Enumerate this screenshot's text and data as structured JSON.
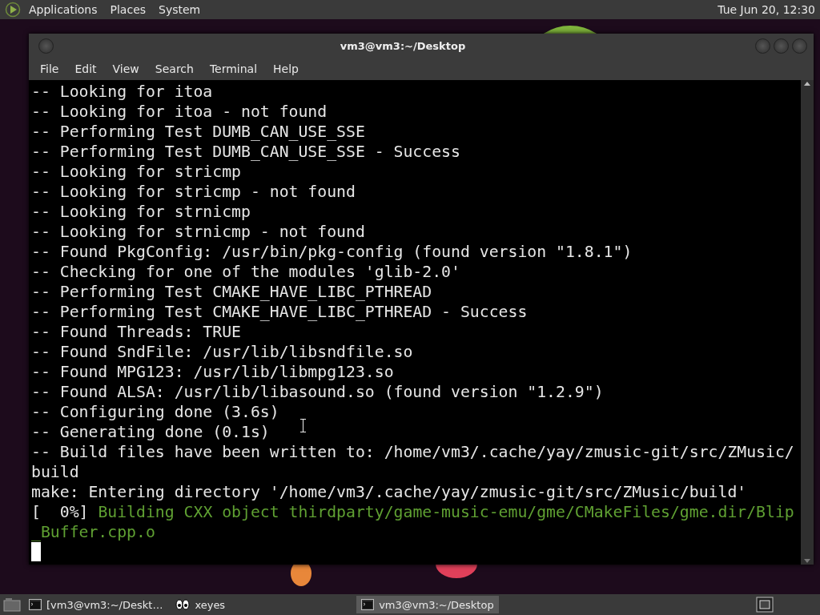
{
  "top_panel": {
    "menus": [
      "Applications",
      "Places",
      "System"
    ],
    "clock": "Tue Jun 20, 12:30"
  },
  "window": {
    "title": "vm3@vm3:~/Desktop",
    "menu": [
      "File",
      "Edit",
      "View",
      "Search",
      "Terminal",
      "Help"
    ],
    "terminal": {
      "cursor": true,
      "lines": [
        [
          {
            "text": "-- Looking for itoa",
            "kind": "plain"
          }
        ],
        [
          {
            "text": "-- Looking for itoa - not found",
            "kind": "plain"
          }
        ],
        [
          {
            "text": "-- Performing Test DUMB_CAN_USE_SSE",
            "kind": "plain"
          }
        ],
        [
          {
            "text": "-- Performing Test DUMB_CAN_USE_SSE - Success",
            "kind": "plain"
          }
        ],
        [
          {
            "text": "-- Looking for stricmp",
            "kind": "plain"
          }
        ],
        [
          {
            "text": "-- Looking for stricmp - not found",
            "kind": "plain"
          }
        ],
        [
          {
            "text": "-- Looking for strnicmp",
            "kind": "plain"
          }
        ],
        [
          {
            "text": "-- Looking for strnicmp - not found",
            "kind": "plain"
          }
        ],
        [
          {
            "text": "-- Found PkgConfig: /usr/bin/pkg-config (found version \"1.8.1\")",
            "kind": "plain"
          }
        ],
        [
          {
            "text": "-- Checking for one of the modules 'glib-2.0'",
            "kind": "plain"
          }
        ],
        [
          {
            "text": "-- Performing Test CMAKE_HAVE_LIBC_PTHREAD",
            "kind": "plain"
          }
        ],
        [
          {
            "text": "-- Performing Test CMAKE_HAVE_LIBC_PTHREAD - Success",
            "kind": "plain"
          }
        ],
        [
          {
            "text": "-- Found Threads: TRUE",
            "kind": "plain"
          }
        ],
        [
          {
            "text": "-- Found SndFile: /usr/lib/libsndfile.so",
            "kind": "plain"
          }
        ],
        [
          {
            "text": "-- Found MPG123: /usr/lib/libmpg123.so",
            "kind": "plain"
          }
        ],
        [
          {
            "text": "-- Found ALSA: /usr/lib/libasound.so (found version \"1.2.9\")",
            "kind": "plain"
          }
        ],
        [
          {
            "text": "-- Configuring done (3.6s)",
            "kind": "plain"
          }
        ],
        [
          {
            "text": "-- Generating done (0.1s)",
            "kind": "plain"
          }
        ],
        [
          {
            "text": "-- Build files have been written to: /home/vm3/.cache/yay/zmusic-git/src/ZMusic/build",
            "kind": "plain"
          }
        ],
        [
          {
            "text": "make: Entering directory '/home/vm3/.cache/yay/zmusic-git/src/ZMusic/build'",
            "kind": "plain"
          }
        ],
        [
          {
            "text": "[  0%]",
            "kind": "plain"
          },
          {
            "text": " Building CXX object thirdparty/game-music-emu/gme/CMakeFiles/gme.dir/Blip_Buffer.cpp.o",
            "kind": "green"
          }
        ]
      ]
    }
  },
  "taskbar": {
    "tasks": [
      {
        "label": "[vm3@vm3:~/Deskt…",
        "kind": "terminal",
        "selected": false
      },
      {
        "label": "xeyes",
        "kind": "eyes",
        "selected": false
      },
      {
        "label": "vm3@vm3:~/Desktop",
        "kind": "terminal",
        "selected": true
      }
    ]
  }
}
